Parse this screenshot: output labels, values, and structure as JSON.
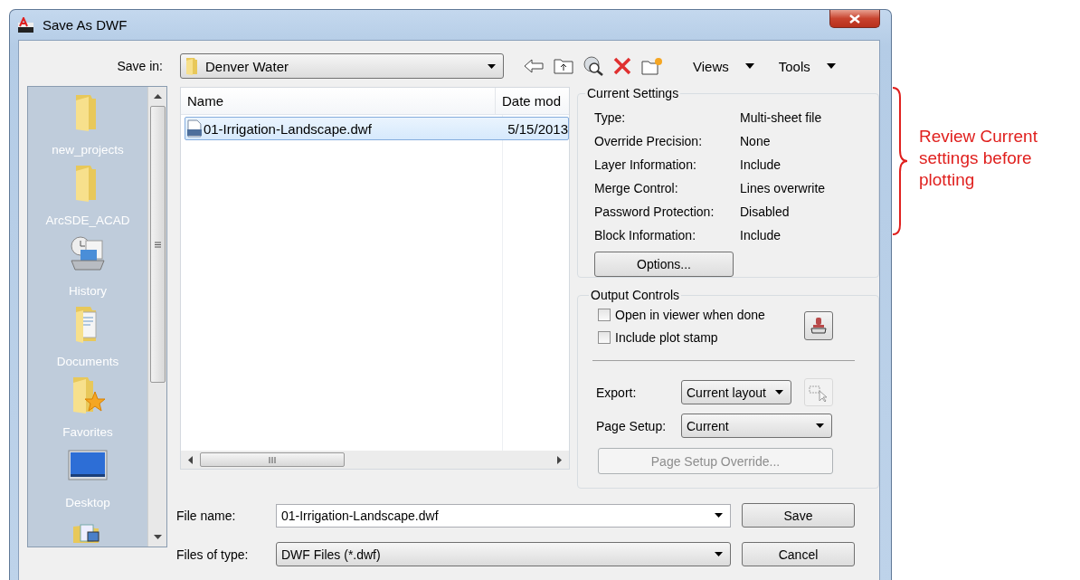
{
  "window": {
    "title": "Save As DWF"
  },
  "save_in": {
    "label": "Save in:",
    "value": "Denver Water"
  },
  "toolbar": {
    "views": "Views",
    "tools": "Tools"
  },
  "places": [
    {
      "kind": "folder",
      "label": "new_projects"
    },
    {
      "kind": "folder",
      "label": "ArcSDE_ACAD"
    },
    {
      "kind": "history",
      "label": "History"
    },
    {
      "kind": "documents",
      "label": "Documents"
    },
    {
      "kind": "favorites",
      "label": "Favorites"
    },
    {
      "kind": "desktop",
      "label": "Desktop"
    },
    {
      "kind": "network"
    }
  ],
  "file_list": {
    "columns": [
      "Name",
      "Date mod"
    ],
    "rows": [
      {
        "name": "01-Irrigation-Landscape.dwf",
        "date": "5/15/2013",
        "selected": true
      }
    ]
  },
  "current_settings": {
    "title": "Current Settings",
    "rows": [
      {
        "label": "Type:",
        "value": "Multi-sheet file"
      },
      {
        "label": "Override Precision:",
        "value": "None"
      },
      {
        "label": "Layer Information:",
        "value": "Include"
      },
      {
        "label": "Merge Control:",
        "value": "Lines overwrite"
      },
      {
        "label": "Password Protection:",
        "value": "Disabled"
      },
      {
        "label": "Block Information:",
        "value": "Include"
      }
    ],
    "options_button": "Options..."
  },
  "output_controls": {
    "title": "Output Controls",
    "checkboxes": [
      {
        "label": "Open in viewer when done",
        "checked": false
      },
      {
        "label": "Include plot stamp",
        "checked": false
      }
    ],
    "export": {
      "label": "Export:",
      "value": "Current layout",
      "pick_disabled": true
    },
    "page_setup": {
      "label": "Page Setup:",
      "value": "Current"
    },
    "override_button": {
      "label": "Page Setup Override...",
      "disabled": true
    }
  },
  "file_name": {
    "label": "File name:",
    "value": "01-Irrigation-Landscape.dwf"
  },
  "file_type": {
    "label": "Files of type:",
    "value": "DWF Files (*.dwf)"
  },
  "buttons": [
    "Save",
    "Cancel"
  ],
  "annotation": "Review Current settings before plotting"
}
